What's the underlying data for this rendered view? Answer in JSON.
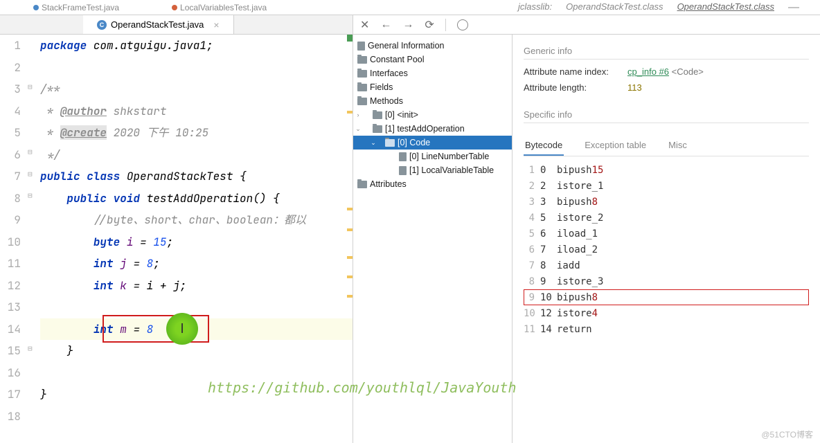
{
  "topTabs": {
    "t1": "StackFrameTest.java",
    "t2": "LocalVariablesTest.java"
  },
  "topRight": {
    "t1": "jclasslib:",
    "t2": "OperandStackTest.class",
    "t3": "OperandStackTest.class"
  },
  "editorTab": "OperandStackTest.java",
  "gutterMax": 18,
  "code": {
    "l1": {
      "kw": "package",
      "rest": " com.atguigu.java1;"
    },
    "l3": "/**",
    "l4": {
      "pre": " * ",
      "tag": "@author",
      "rest": " shkstart"
    },
    "l5": {
      "pre": " * ",
      "tag": "@create",
      "rest": " 2020 下午 10:25"
    },
    "l6": " */",
    "l7": {
      "kw1": "public",
      "kw2": "class",
      "cls": "OperandStackTest",
      "br": " {"
    },
    "l8": {
      "kw1": "public",
      "kw2": "void",
      "m": "testAddOperation",
      "rest": "() {"
    },
    "l9": "//byte、short、char、boolean：都以",
    "l10": {
      "kw": "byte",
      "v": "i",
      "n": "15"
    },
    "l11": {
      "kw": "int",
      "v": "j",
      "n": "8"
    },
    "l12": {
      "kw": "int",
      "v": "k",
      "rest": "i + j"
    },
    "l14": {
      "kw": "int",
      "v": "m",
      "n": "8"
    },
    "l15": "}",
    "l17": "}"
  },
  "watermark": "https://github.com/youthlql/JavaYouth",
  "blogmark": "@51CTO博客",
  "tree": {
    "n1": "General Information",
    "n2": "Constant Pool",
    "n3": "Interfaces",
    "n4": "Fields",
    "n5": "Methods",
    "n6": "[0] <init>",
    "n7": "[1] testAddOperation",
    "n8": "[0] Code",
    "n9": "[0] LineNumberTable",
    "n10": "[1] LocalVariableTable",
    "n11": "Attributes"
  },
  "detail": {
    "hdr1": "Generic info",
    "attrNameLbl": "Attribute name index:",
    "cpinfo": "cp_info #6",
    "cpcode": "<Code>",
    "attrLenLbl": "Attribute length:",
    "attrLenVal": "113",
    "hdr2": "Specific info",
    "tabs": {
      "t1": "Bytecode",
      "t2": "Exception table",
      "t3": "Misc"
    }
  },
  "bytecode": [
    {
      "ln": "1",
      "off": "0",
      "op": "bipush",
      "arg": "15"
    },
    {
      "ln": "2",
      "off": "2",
      "op": "istore_1",
      "arg": ""
    },
    {
      "ln": "3",
      "off": "3",
      "op": "bipush",
      "arg": "8"
    },
    {
      "ln": "4",
      "off": "5",
      "op": "istore_2",
      "arg": ""
    },
    {
      "ln": "5",
      "off": "6",
      "op": "iload_1",
      "arg": ""
    },
    {
      "ln": "6",
      "off": "7",
      "op": "iload_2",
      "arg": ""
    },
    {
      "ln": "7",
      "off": "8",
      "op": "iadd",
      "arg": ""
    },
    {
      "ln": "8",
      "off": "9",
      "op": "istore_3",
      "arg": ""
    },
    {
      "ln": "9",
      "off": "10",
      "op": "bipush",
      "arg": "8",
      "boxed": true
    },
    {
      "ln": "10",
      "off": "12",
      "op": "istore",
      "arg": "4"
    },
    {
      "ln": "11",
      "off": "14",
      "op": "return",
      "arg": ""
    }
  ]
}
